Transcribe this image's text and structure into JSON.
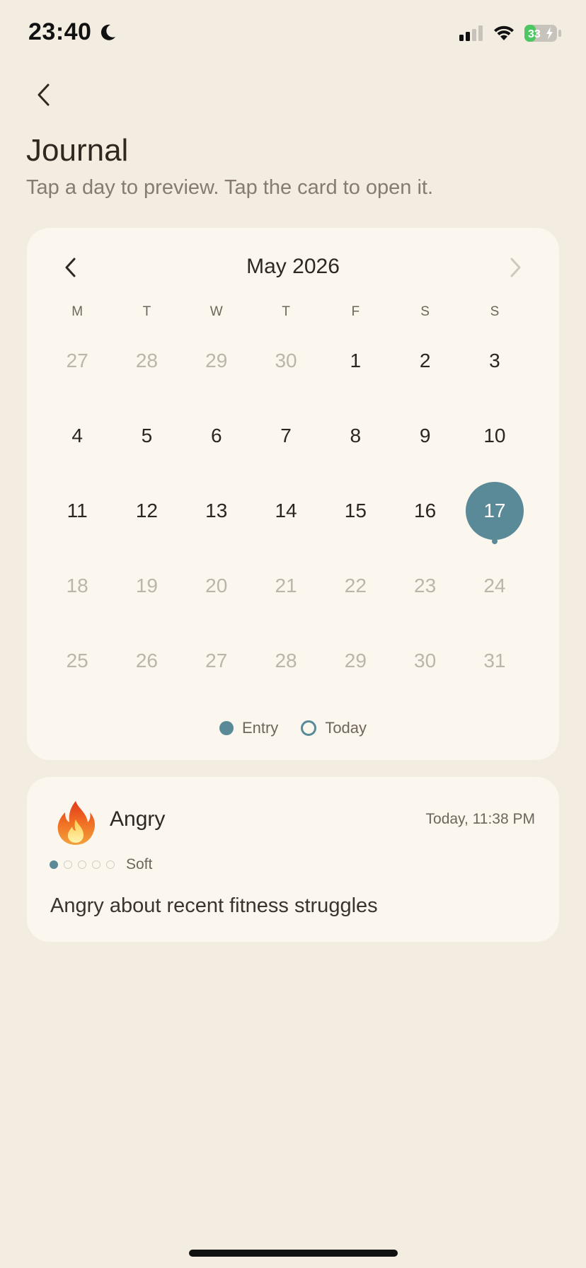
{
  "status_bar": {
    "time": "23:40",
    "battery": "33"
  },
  "header": {
    "title": "Journal",
    "subtitle": "Tap a day to preview. Tap the card to open it."
  },
  "calendar": {
    "month_label": "May 2026",
    "weekdays": [
      "M",
      "T",
      "W",
      "T",
      "F",
      "S",
      "S"
    ],
    "weeks": [
      [
        {
          "day": "27",
          "muted": true
        },
        {
          "day": "28",
          "muted": true
        },
        {
          "day": "29",
          "muted": true
        },
        {
          "day": "30",
          "muted": true
        },
        {
          "day": "1",
          "muted": false
        },
        {
          "day": "2",
          "muted": false
        },
        {
          "day": "3",
          "muted": false
        }
      ],
      [
        {
          "day": "4",
          "muted": false
        },
        {
          "day": "5",
          "muted": false
        },
        {
          "day": "6",
          "muted": false
        },
        {
          "day": "7",
          "muted": false
        },
        {
          "day": "8",
          "muted": false
        },
        {
          "day": "9",
          "muted": false
        },
        {
          "day": "10",
          "muted": false
        }
      ],
      [
        {
          "day": "11",
          "muted": false
        },
        {
          "day": "12",
          "muted": false
        },
        {
          "day": "13",
          "muted": false
        },
        {
          "day": "14",
          "muted": false
        },
        {
          "day": "15",
          "muted": false
        },
        {
          "day": "16",
          "muted": false
        },
        {
          "day": "17",
          "muted": false,
          "selected": true,
          "has_entry": true
        }
      ],
      [
        {
          "day": "18",
          "muted": true
        },
        {
          "day": "19",
          "muted": true
        },
        {
          "day": "20",
          "muted": true
        },
        {
          "day": "21",
          "muted": true
        },
        {
          "day": "22",
          "muted": true
        },
        {
          "day": "23",
          "muted": true
        },
        {
          "day": "24",
          "muted": true
        }
      ],
      [
        {
          "day": "25",
          "muted": true
        },
        {
          "day": "26",
          "muted": true
        },
        {
          "day": "27",
          "muted": true
        },
        {
          "day": "28",
          "muted": true
        },
        {
          "day": "29",
          "muted": true
        },
        {
          "day": "30",
          "muted": true
        },
        {
          "day": "31",
          "muted": true
        }
      ]
    ],
    "legend": {
      "entry_label": "Entry",
      "today_label": "Today"
    }
  },
  "entry_preview": {
    "emoji": "🔥",
    "mood": "Angry",
    "timestamp": "Today, 11:38 PM",
    "intensity_level": 1,
    "intensity_max": 5,
    "intensity_label": "Soft",
    "text": "Angry about recent fitness struggles"
  },
  "colors": {
    "background": "#F3ECE0",
    "card": "#FBF6EE",
    "accent": "#5A8A98",
    "muted_text": "#BDB4AA",
    "battery_green": "#4CC763"
  },
  "icons": {
    "status_moon": "moon-icon",
    "signal": "signal-icon",
    "wifi": "wifi-icon",
    "battery": "battery-icon",
    "back": "chevron-left-icon",
    "prev_month": "chevron-left-icon",
    "next_month": "chevron-right-icon",
    "mood": "fire-icon"
  }
}
